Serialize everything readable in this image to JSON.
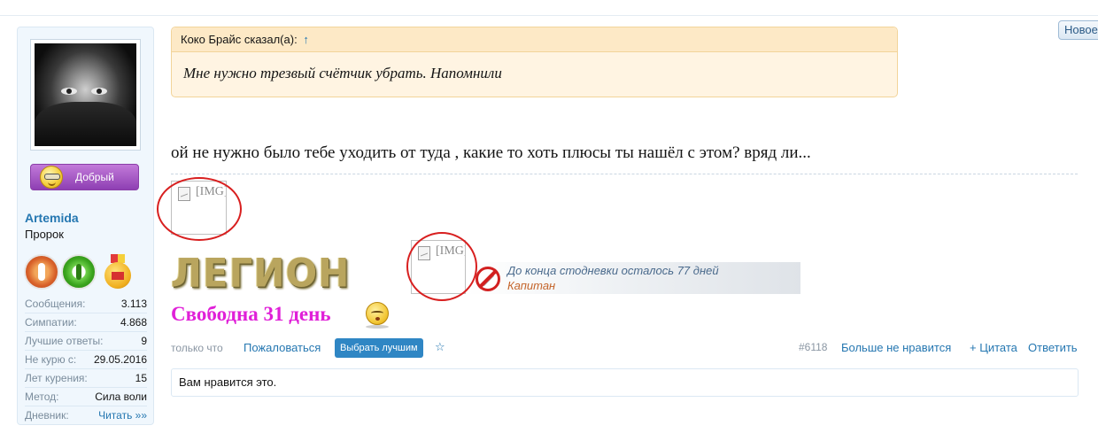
{
  "header": {
    "new_button_label": "Новое"
  },
  "user": {
    "name": "Artemida",
    "title": "Пророк",
    "mood_label": "Добрый",
    "stats": [
      {
        "label": "Сообщения:",
        "value": "3.113"
      },
      {
        "label": "Симпатии:",
        "value": "4.868"
      },
      {
        "label": "Лучшие ответы:",
        "value": "9"
      },
      {
        "label": "Не курю с:",
        "value": "29.05.2016"
      },
      {
        "label": "Лет курения:",
        "value": "15"
      },
      {
        "label": "Метод:",
        "value": "Сила воли"
      },
      {
        "label": "Дневник:",
        "value": "Читать »»"
      }
    ]
  },
  "quote": {
    "author_line": "Коко Брайс сказал(а):",
    "jump_arrow": "↑",
    "text": "Мне нужно трезвый счётчик убрать. Напомнили"
  },
  "message": {
    "text": "ой не нужно было тебе уходить от туда , какие то хоть плюсы ты нашёл с этом? вряд ли..."
  },
  "signature": {
    "broken_image_alt": "[IMG]",
    "legion_text": "ЛЕГИОН",
    "counter_line1": "До конца стодневки осталось 77 дней",
    "counter_line2": "Капитан",
    "free_days_text": "Свободна 31 день"
  },
  "actions": {
    "time": "только что",
    "report": "Пожаловаться",
    "best_answer": "Выбрать лучшим",
    "star": "☆",
    "post_number": "#6118",
    "unlike": "Больше не нравится",
    "quote": "+ Цитата",
    "reply": "Ответить"
  },
  "likes": {
    "text": "Вам нравится это."
  },
  "colors": {
    "link": "#2577b1",
    "quote_bg": "#fff4e2",
    "sidebar_bg": "#f0f7fd",
    "magenta_text": "#e020d8",
    "annotation_red": "#d81f1f"
  }
}
